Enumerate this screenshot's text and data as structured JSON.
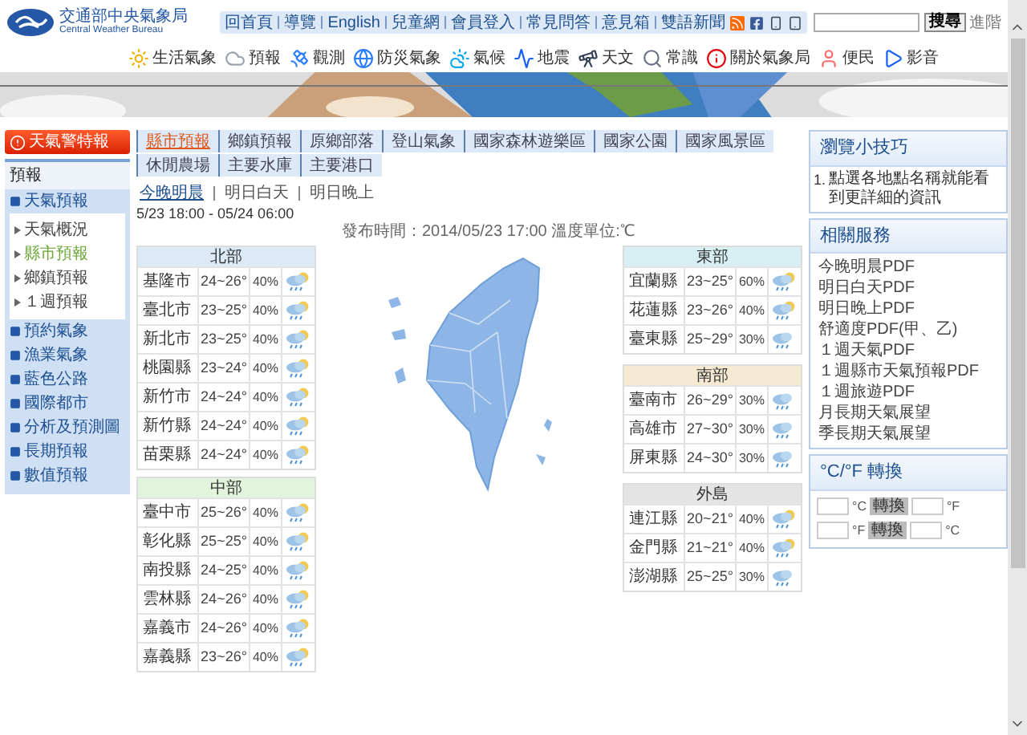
{
  "header": {
    "logo_title": "交通部中央氣象局",
    "logo_subtitle": "Central Weather Bureau",
    "top_links": [
      "回首頁",
      "導覽",
      "English",
      "兒童網",
      "會員登入",
      "常見問答",
      "意見箱",
      "雙語新聞"
    ],
    "search": {
      "button": "搜尋",
      "advanced": "進階"
    }
  },
  "nav": [
    {
      "label": "生活氣象",
      "kind": "sun"
    },
    {
      "label": "預報",
      "kind": "cloud"
    },
    {
      "label": "觀測",
      "kind": "satellite"
    },
    {
      "label": "防災氣象",
      "kind": "globe"
    },
    {
      "label": "氣候",
      "kind": "cloud-sun"
    },
    {
      "label": "地震",
      "kind": "chart"
    },
    {
      "label": "天文",
      "kind": "telescope"
    },
    {
      "label": "常識",
      "kind": "search"
    },
    {
      "label": "關於氣象局",
      "kind": "info"
    },
    {
      "label": "便民",
      "kind": "user"
    },
    {
      "label": "影音",
      "kind": "play"
    }
  ],
  "sidebar": {
    "alert_button": "天氣警特報",
    "section": "預報",
    "current": "天氣預報",
    "sub_items": [
      {
        "label": "天氣概況",
        "selected": false
      },
      {
        "label": "縣市預報",
        "selected": true
      },
      {
        "label": "鄉鎮預報",
        "selected": false
      },
      {
        "label": "１週預報",
        "selected": false
      }
    ],
    "links": [
      "預約氣象",
      "漁業氣象",
      "藍色公路",
      "國際都市",
      "分析及預測圖",
      "長期預報",
      "數值預報"
    ]
  },
  "tabs": [
    {
      "label": "縣市預報",
      "selected": true
    },
    {
      "label": "鄉鎮預報",
      "selected": false
    },
    {
      "label": "原鄉部落",
      "selected": false
    },
    {
      "label": "登山氣象",
      "selected": false
    },
    {
      "label": "國家森林遊樂區",
      "selected": false
    },
    {
      "label": "國家公園",
      "selected": false
    },
    {
      "label": "國家風景區",
      "selected": false
    },
    {
      "label": "休閒農場",
      "selected": false
    },
    {
      "label": "主要水庫",
      "selected": false
    },
    {
      "label": "主要港口",
      "selected": false
    }
  ],
  "period_tabs": [
    {
      "label": "今晚明晨",
      "selected": true
    },
    {
      "label": "明日白天",
      "selected": false
    },
    {
      "label": "明日晚上",
      "selected": false
    }
  ],
  "period": "5/23 18:00 - 05/24 06:00",
  "issued": "發布時間：2014/05/23 17:00 溫度單位:℃",
  "regions": [
    {
      "name": "北部",
      "color": "#dce9f7",
      "rows": [
        {
          "county": "基隆市",
          "temp": "24~26°",
          "rain": "40%",
          "kind": "partly-cloudy-rain"
        },
        {
          "county": "臺北市",
          "temp": "23~25°",
          "rain": "40%",
          "kind": "partly-cloudy-rain"
        },
        {
          "county": "新北市",
          "temp": "23~25°",
          "rain": "40%",
          "kind": "partly-cloudy-rain"
        },
        {
          "county": "桃園縣",
          "temp": "23~24°",
          "rain": "40%",
          "kind": "partly-cloudy-rain"
        },
        {
          "county": "新竹市",
          "temp": "24~24°",
          "rain": "40%",
          "kind": "partly-cloudy-rain"
        },
        {
          "county": "新竹縣",
          "temp": "24~24°",
          "rain": "40%",
          "kind": "partly-cloudy-rain"
        },
        {
          "county": "苗栗縣",
          "temp": "24~24°",
          "rain": "40%",
          "kind": "partly-cloudy-rain"
        }
      ]
    },
    {
      "name": "中部",
      "color": "#e3f4dc",
      "rows": [
        {
          "county": "臺中市",
          "temp": "25~26°",
          "rain": "40%",
          "kind": "partly-cloudy-rain"
        },
        {
          "county": "彰化縣",
          "temp": "25~25°",
          "rain": "40%",
          "kind": "partly-cloudy-rain"
        },
        {
          "county": "南投縣",
          "temp": "24~25°",
          "rain": "40%",
          "kind": "partly-cloudy-rain"
        },
        {
          "county": "雲林縣",
          "temp": "24~26°",
          "rain": "40%",
          "kind": "partly-cloudy-rain"
        },
        {
          "county": "嘉義市",
          "temp": "24~26°",
          "rain": "40%",
          "kind": "partly-cloudy-rain"
        },
        {
          "county": "嘉義縣",
          "temp": "23~26°",
          "rain": "40%",
          "kind": "partly-cloudy-rain"
        }
      ]
    },
    {
      "name": "東部",
      "color": "#d6f0f4",
      "rows": [
        {
          "county": "宜蘭縣",
          "temp": "23~25°",
          "rain": "60%",
          "kind": "partly-cloudy-rain"
        },
        {
          "county": "花蓮縣",
          "temp": "23~26°",
          "rain": "40%",
          "kind": "partly-cloudy-rain"
        },
        {
          "county": "臺東縣",
          "temp": "25~29°",
          "rain": "30%",
          "kind": "cloudy-rain"
        }
      ]
    },
    {
      "name": "南部",
      "color": "#f6ead3",
      "rows": [
        {
          "county": "臺南市",
          "temp": "26~29°",
          "rain": "30%",
          "kind": "cloudy-rain"
        },
        {
          "county": "高雄市",
          "temp": "27~30°",
          "rain": "30%",
          "kind": "cloudy-rain"
        },
        {
          "county": "屏東縣",
          "temp": "24~30°",
          "rain": "30%",
          "kind": "cloudy-rain"
        }
      ]
    },
    {
      "name": "外島",
      "color": "#e4e4e4",
      "rows": [
        {
          "county": "連江縣",
          "temp": "20~21°",
          "rain": "40%",
          "kind": "partly-cloudy-rain"
        },
        {
          "county": "金門縣",
          "temp": "21~21°",
          "rain": "40%",
          "kind": "partly-cloudy-rain"
        },
        {
          "county": "澎湖縣",
          "temp": "25~25°",
          "rain": "30%",
          "kind": "cloudy-rain"
        }
      ]
    }
  ],
  "tips": {
    "title": "瀏覽小技巧",
    "items": [
      {
        "number": "1.",
        "text": "點選各地點名稱就能看到更詳細的資訊"
      }
    ]
  },
  "services": {
    "title": "相關服務",
    "links": [
      "今晚明晨PDF",
      "明日白天PDF",
      "明日晚上PDF",
      "舒適度PDF(甲、乙)",
      "１週天氣PDF",
      "１週縣市天氣預報PDF",
      "１週旅遊PDF",
      "月長期天氣展望",
      "季長期天氣展望"
    ]
  },
  "converter": {
    "title": "°C/°F 轉換",
    "rows": [
      {
        "from": "°C",
        "button": "轉換",
        "to": "°F"
      },
      {
        "from": "°F",
        "button": "轉換",
        "to": "°C"
      }
    ]
  }
}
